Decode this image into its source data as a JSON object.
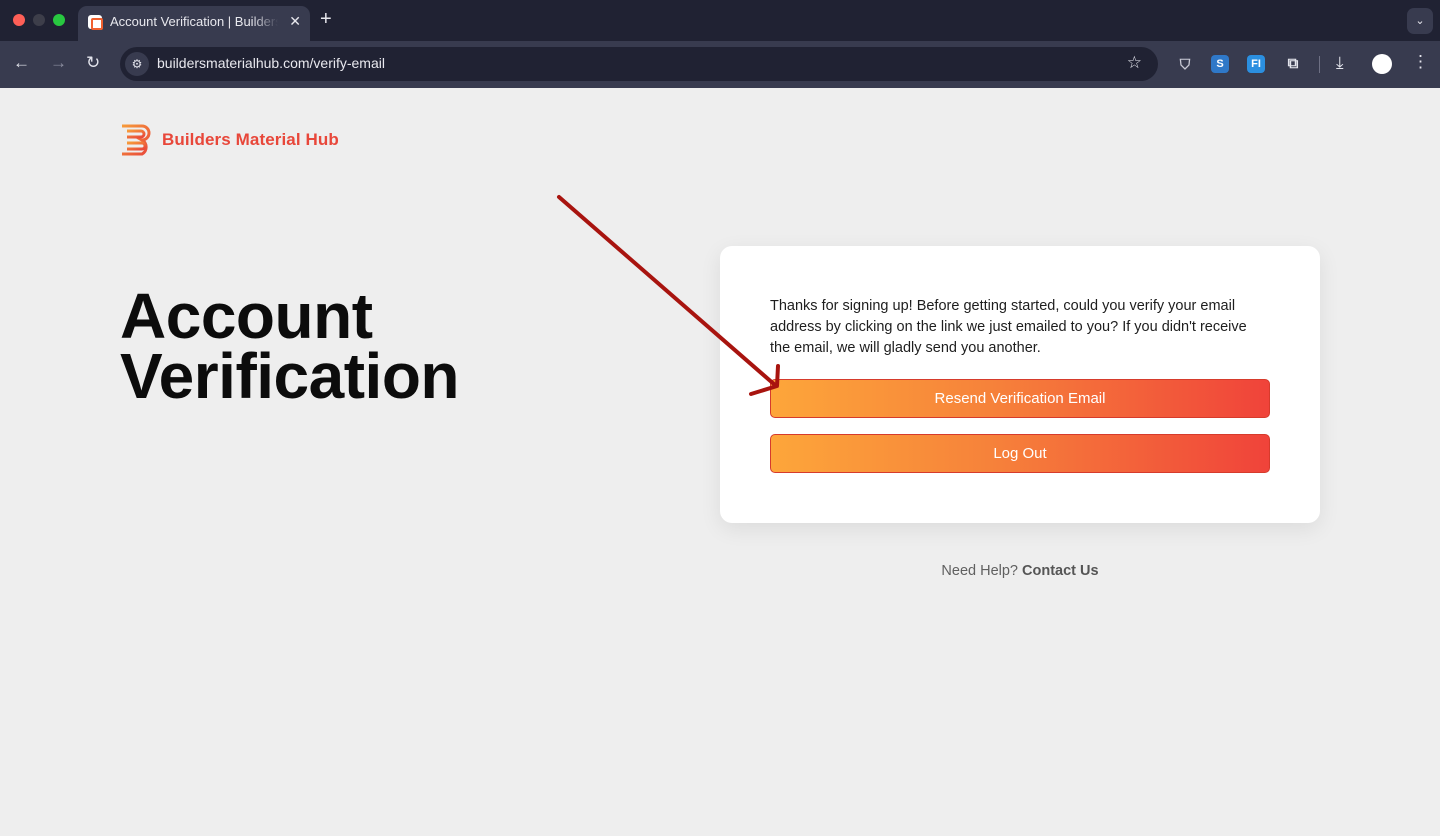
{
  "browser": {
    "tab_title": "Account Verification | Builders Material Hub",
    "tab_close": "✕",
    "new_tab": "+",
    "tab_menu": "⌄",
    "url": "buildersmaterialhub.com/verify-email",
    "icons": {
      "back": "←",
      "forward": "→",
      "reload": "↻",
      "site_info": "⚙",
      "star": "☆",
      "shield": "⛉",
      "ext_s": "S",
      "ext_fi": "FI",
      "puzzle": "⧉",
      "download": "⤓",
      "menu": "⋮"
    }
  },
  "logo": {
    "text": "Builders Material Hub",
    "colors": {
      "orange": "#f79b3a",
      "red": "#e8473a"
    }
  },
  "page": {
    "heading_line1": "Account",
    "heading_line2": "Verification"
  },
  "card": {
    "message": "Thanks for signing up! Before getting started, could you verify your email address by clicking on the link we just emailed to you? If you didn't receive the email, we will gladly send you another.",
    "resend_button": "Resend Verification Email",
    "logout_button": "Log Out"
  },
  "help": {
    "text": "Need Help?",
    "link": "Contact Us"
  },
  "colors": {
    "gradient_start": "#fda63a",
    "gradient_end": "#f0433a",
    "annotation_arrow": "#a8140f",
    "page_bg": "#eeeeee"
  }
}
